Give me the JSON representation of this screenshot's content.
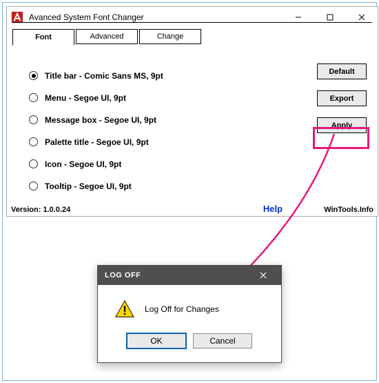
{
  "mainWindow": {
    "title": "Avanced System Font Changer",
    "tabs": [
      {
        "label": "Font",
        "active": true
      },
      {
        "label": "Advanced",
        "active": false
      },
      {
        "label": "Change",
        "active": false
      }
    ],
    "radios": [
      {
        "label": "Title bar - Comic Sans MS, 9pt",
        "selected": true
      },
      {
        "label": "Menu - Segoe UI, 9pt",
        "selected": false
      },
      {
        "label": "Message box - Segoe UI, 9pt",
        "selected": false
      },
      {
        "label": "Palette title - Segoe UI, 9pt",
        "selected": false
      },
      {
        "label": "Icon - Segoe UI, 9pt",
        "selected": false
      },
      {
        "label": "Tooltip - Segoe UI, 9pt",
        "selected": false
      }
    ],
    "buttons": {
      "default": "Default",
      "export": "Export",
      "apply": "Apply"
    },
    "help": "Help",
    "version": "Version: 1.0.0.24",
    "brand": "WinTools.Info"
  },
  "dialog": {
    "title": "LOG OFF",
    "message": "Log Off for Changes",
    "ok": "OK",
    "cancel": "Cancel"
  },
  "annotation": {
    "highlightColor": "#e6177b"
  }
}
